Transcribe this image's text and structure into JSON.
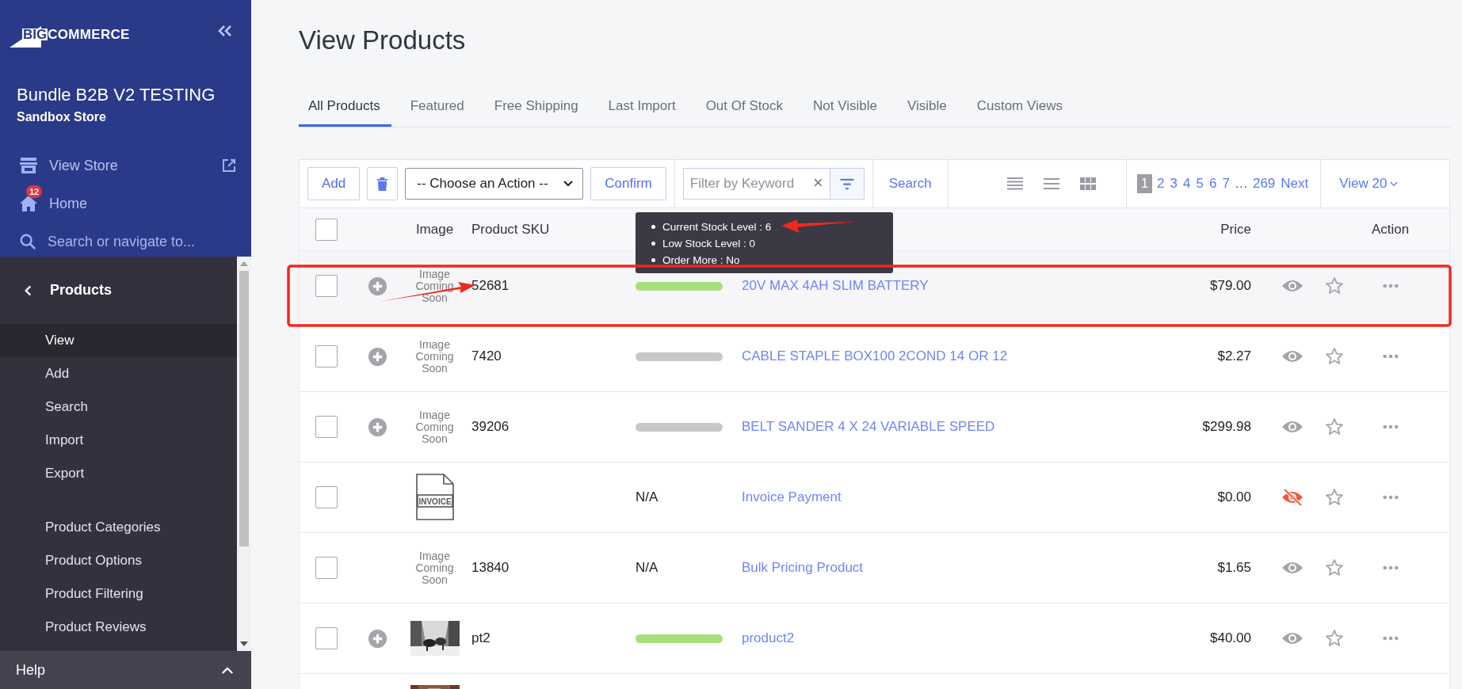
{
  "sidebar": {
    "logo_lead": "BIG",
    "logo_rest": "COMMERCE",
    "store_name": "Bundle B2B V2 TESTING",
    "store_type": "Sandbox Store",
    "nav": [
      {
        "kind": "store",
        "label": "View Store"
      },
      {
        "kind": "home",
        "label": "Home",
        "badge": "12"
      },
      {
        "kind": "search",
        "placeholder": "Search or navigate to..."
      }
    ],
    "section": "Products",
    "groups": [
      [
        {
          "label": "View",
          "selected": true
        },
        {
          "label": "Add",
          "selected": false
        },
        {
          "label": "Search",
          "selected": false
        },
        {
          "label": "Import",
          "selected": false
        },
        {
          "label": "Export",
          "selected": false
        }
      ],
      [
        {
          "label": "Product Categories",
          "selected": false
        },
        {
          "label": "Product Options",
          "selected": false
        },
        {
          "label": "Product Filtering",
          "selected": false
        },
        {
          "label": "Product Reviews",
          "selected": false
        }
      ]
    ],
    "footer": "Help"
  },
  "page_title": "View Products",
  "tabs": [
    {
      "label": "All Products",
      "selected": true
    },
    {
      "label": "Featured",
      "selected": false
    },
    {
      "label": "Free Shipping",
      "selected": false
    },
    {
      "label": "Last Import",
      "selected": false
    },
    {
      "label": "Out Of Stock",
      "selected": false
    },
    {
      "label": "Not Visible",
      "selected": false
    },
    {
      "label": "Visible",
      "selected": false
    },
    {
      "label": "Custom Views",
      "selected": false
    }
  ],
  "toolbar": {
    "add": "Add",
    "action_select": "-- Choose an Action --",
    "confirm": "Confirm",
    "filter_placeholder": "Filter by Keyword",
    "clear": "×",
    "search": "Search",
    "pages": [
      {
        "label": "1",
        "selected": true
      },
      {
        "label": "2",
        "selected": false
      },
      {
        "label": "3",
        "selected": false
      },
      {
        "label": "4",
        "selected": false
      },
      {
        "label": "5",
        "selected": false
      },
      {
        "label": "6",
        "selected": false
      },
      {
        "label": "7",
        "selected": false
      }
    ],
    "ellipsis": "…",
    "last_page": "269",
    "next": "Next",
    "view": "View 20"
  },
  "table": {
    "select_all_checked": false,
    "columns": {
      "image": "Image",
      "sku": "Product SKU",
      "price": "Price",
      "action": "Action"
    },
    "tooltip": [
      "Current Stock Level : 6",
      "Low Stock Level : 0",
      "Order More : No"
    ],
    "rows": [
      {
        "checked": false,
        "highlighted": true,
        "expandable": true,
        "image": {
          "kind": "placeholder",
          "text": "Image Coming Soon"
        },
        "sku": "52681",
        "stock": {
          "kind": "bar",
          "color": "#a8df7e"
        },
        "name": "20V MAX 4AH SLIM BATTERY",
        "price": "$79.00",
        "visible": true,
        "featured": false
      },
      {
        "checked": false,
        "highlighted": false,
        "expandable": true,
        "image": {
          "kind": "placeholder",
          "text": "Image Coming Soon"
        },
        "sku": "7420",
        "stock": {
          "kind": "bar",
          "color": "#c8c8cb"
        },
        "name": "CABLE STAPLE BOX100 2COND 14 OR 12",
        "price": "$2.27",
        "visible": true,
        "featured": false
      },
      {
        "checked": false,
        "highlighted": false,
        "expandable": true,
        "image": {
          "kind": "placeholder",
          "text": "Image Coming Soon"
        },
        "sku": "39206",
        "stock": {
          "kind": "bar",
          "color": "#c8c8cb"
        },
        "name": "BELT SANDER 4 X 24 VARIABLE SPEED",
        "price": "$299.98",
        "visible": true,
        "featured": false
      },
      {
        "checked": false,
        "highlighted": false,
        "expandable": false,
        "image": {
          "kind": "invoice",
          "text": "INVOICE"
        },
        "stock": {
          "kind": "text",
          "text": "N/A"
        },
        "name": "Invoice Payment",
        "price": "$0.00",
        "visible": false,
        "featured": false
      },
      {
        "checked": false,
        "highlighted": false,
        "expandable": false,
        "image": {
          "kind": "placeholder",
          "text": "Image Coming Soon"
        },
        "sku": "13840",
        "stock": {
          "kind": "text",
          "text": "N/A"
        },
        "name": "Bulk Pricing Product",
        "price": "$1.65",
        "visible": true,
        "featured": false
      },
      {
        "checked": false,
        "highlighted": false,
        "expandable": true,
        "sku": "pt2",
        "stock": {
          "kind": "bar",
          "color": "#a8df7e"
        },
        "name": "product2",
        "price": "$40.00",
        "visible": true,
        "featured": false
      },
      {
        "image": {
          "kind": "photo_cut"
        }
      }
    ]
  }
}
